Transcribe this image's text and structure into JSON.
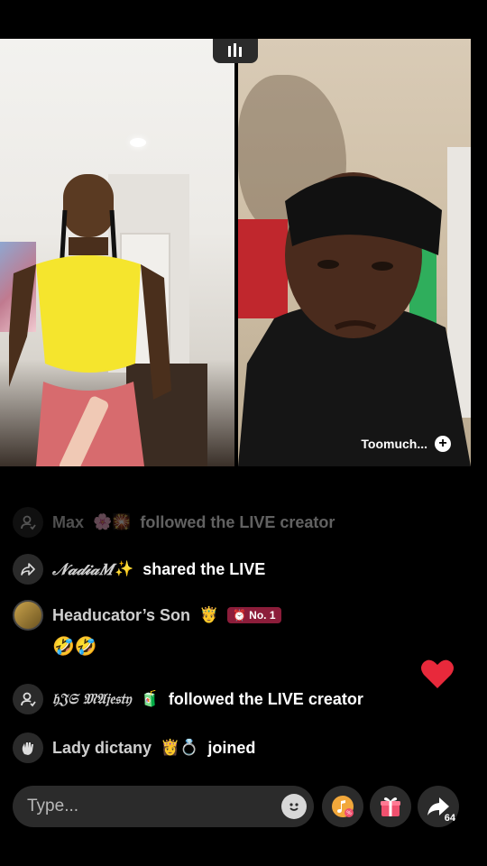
{
  "stream": {
    "opponent_name": "Toomuch...",
    "follow_symbol": "+"
  },
  "chat": {
    "messages": [
      {
        "type": "follow",
        "user": "Max",
        "user_decor": "🌸🎇",
        "action": "followed the LIVE creator"
      },
      {
        "type": "share",
        "user": "𝒩𝒶𝒹𝒾𝒶𝑀",
        "user_decor": "✨",
        "action": "shared the LIVE"
      },
      {
        "type": "comment",
        "user": "Headucator’s Son",
        "user_decor": "🤴",
        "badge": "No. 1",
        "text": "🤣🤣"
      },
      {
        "type": "follow",
        "user": "𝔥𝔍𝔖 𝔐𝔄𝔧𝔢𝔰𝔱𝔶",
        "user_decor": "🧃",
        "action": "followed the LIVE creator"
      },
      {
        "type": "join",
        "user": "Lady dictany",
        "user_decor": "👸💍",
        "action": "joined"
      }
    ]
  },
  "input": {
    "placeholder": "Type..."
  },
  "actions": {
    "share_count": "64"
  },
  "colors": {
    "background": "#000000",
    "like_heart": "#e8293b",
    "rank_badge": "#8c1d3a",
    "gift_pink": "#f0506e"
  }
}
